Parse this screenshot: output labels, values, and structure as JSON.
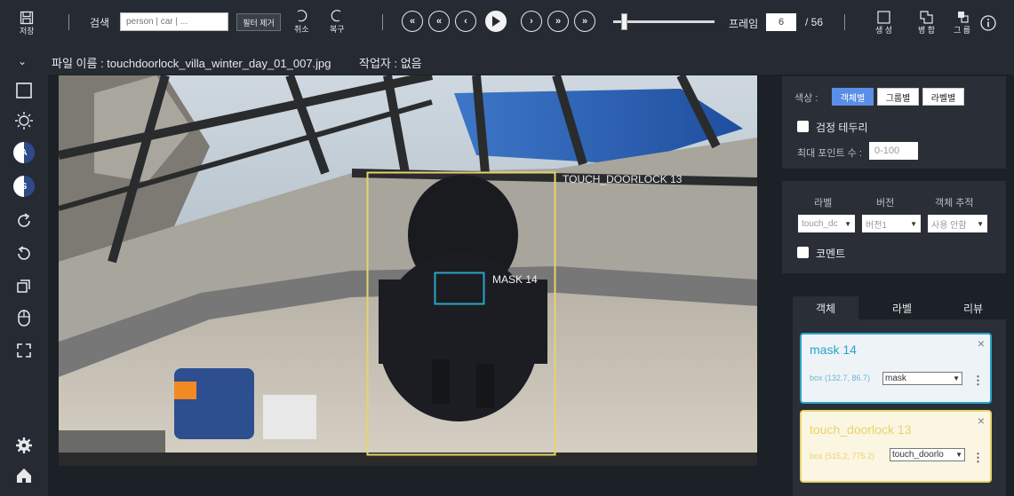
{
  "toolbar": {
    "save_label": "저장",
    "search_label": "검색",
    "search_placeholder": "person | car | ...",
    "filter_reset_label": "필터 제거",
    "undo_label": "취소",
    "redo_label": "복구",
    "frame_label": "프레임",
    "frame_current": "6",
    "frame_total": "/ 56",
    "frame_progress": 0.107,
    "create_label": "생 성",
    "merge_label": "병 합",
    "group_label": "그 룹"
  },
  "file": {
    "name_text": "파일 이름 : touchdoorlock_villa_winter_day_01_007.jpg",
    "author_text": "작업자 : 없음"
  },
  "left_tools": {
    "auto_label": "A",
    "select_label": "S"
  },
  "canvas": {
    "box_large_label": "TOUCH_DOORLOCK 13",
    "box_small_label": "MASK 14",
    "box_large_color": "#e8d36a",
    "box_small_color": "#2ba3c9"
  },
  "right_panel": {
    "color_label": "색상 :",
    "color_by_object": "객체별",
    "color_by_group": "그룹별",
    "color_by_label": "라벨별",
    "black_border_label": "검정 테두리",
    "max_points_label": "최대 포인트 수 :",
    "max_points_placeholder": "0-100",
    "label_header": "라벨",
    "version_header": "버전",
    "tracking_header": "객체 추적",
    "label_value": "touch_dc",
    "version_value": "버전1",
    "tracking_value": "사용 안함",
    "comment_label": "코멘트",
    "tabs": [
      "객체",
      "라벨",
      "리뷰"
    ],
    "objects": [
      {
        "title": "mask 14",
        "box": "box (132.7, 86.7)",
        "label": "mask",
        "color": "#2ba3c9"
      },
      {
        "title": "touch_doorlock 13",
        "box": "box (515.2, 775.2)",
        "label": "touch_doorlo",
        "color": "#e8d36a"
      }
    ]
  }
}
